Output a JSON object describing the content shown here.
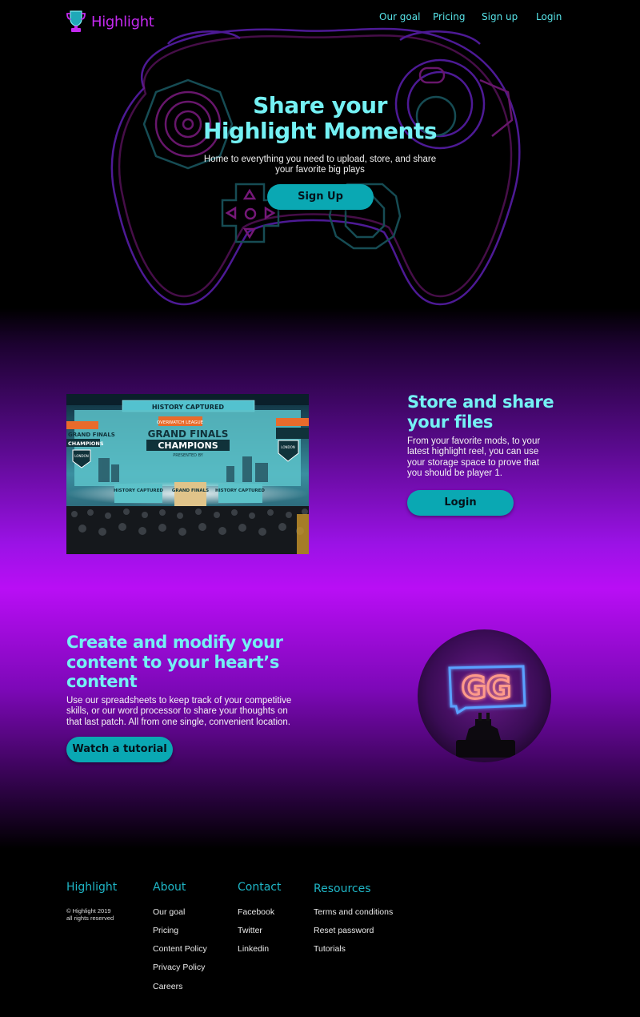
{
  "brand": {
    "name": "Highlight",
    "accent": "#c429f0",
    "cyan": "#74f1f4",
    "teal": "#0aa8b3"
  },
  "nav": {
    "items": [
      "Our goal",
      "Pricing",
      "Sign up",
      "Login"
    ]
  },
  "hero": {
    "title_line1": "Share your",
    "title_line2": "Highlight Moments",
    "subtitle_line1": "Home to everything you need to upload, store, and share",
    "subtitle_line2": "your favorite big plays",
    "cta": "Sign Up"
  },
  "store": {
    "title_line1": "Store and share",
    "title_line2": "your files",
    "text_lines": [
      "From your favorite mods, to your",
      "latest highlight reel, you can use",
      "your storage space to prove that",
      "you should be player 1."
    ],
    "cta": "Login",
    "photo": {
      "banner": "HISTORY CAPTURED",
      "league": "OVERWATCH LEAGUE",
      "line1": "GRAND FINALS",
      "line2": "CHAMPIONS",
      "line3": "PRESENTED BY",
      "team": "LONDON",
      "side_left_1": "GRAND FINALS",
      "side_left_2": "CHAMPIONS",
      "stage_left": "HISTORY CAPTURED",
      "stage_mid": "GRAND FINALS",
      "stage_right": "HISTORY CAPTURED"
    }
  },
  "create": {
    "title_lines": [
      "Create and modify your",
      "content to your heart’s",
      "content"
    ],
    "text_lines": [
      "Use our spreadsheets to keep track of your competitive",
      "skills, or our word processor to share your thoughts on",
      "that last patch. All from one single, convenient location."
    ],
    "cta": "Watch a tutorial",
    "sign_text": "GG"
  },
  "footer": {
    "brand": "Highlight",
    "copyright_line1": "© Highlight 2019",
    "copyright_line2": "all rights reserved",
    "columns": [
      {
        "heading": "About",
        "links": [
          "Our goal",
          "Pricing",
          "Content Policy",
          "Privacy Policy",
          "Careers"
        ]
      },
      {
        "heading": "Contact",
        "links": [
          "Facebook",
          "Twitter",
          "Linkedin"
        ]
      },
      {
        "heading": "Resources",
        "links": [
          "Terms and conditions",
          "Reset password",
          "Tutorials"
        ]
      }
    ]
  }
}
